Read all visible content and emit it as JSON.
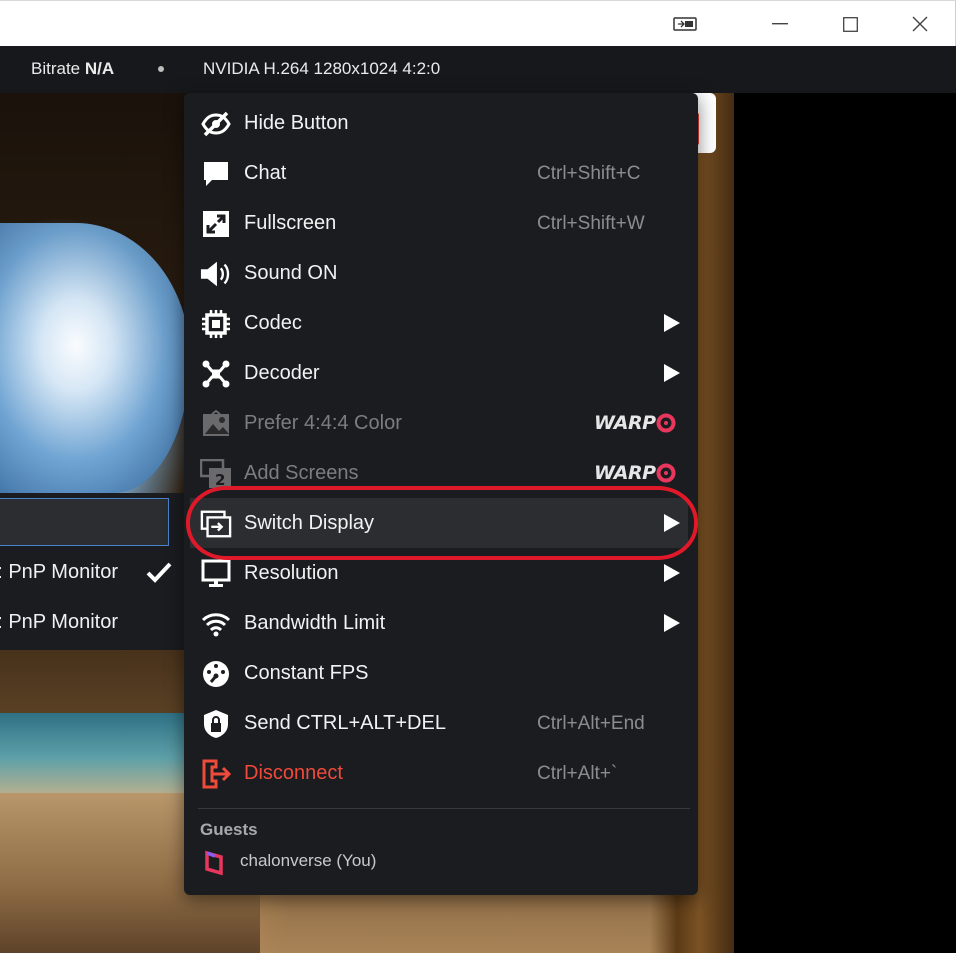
{
  "window": {
    "controls": [
      "mirror-icon",
      "minimize-icon",
      "maximize-icon",
      "close-icon"
    ]
  },
  "stats": {
    "bitrate_label": "Bitrate",
    "bitrate_value": "N/A",
    "codec_info": "NVIDIA H.264 1280x1024 4:2:0"
  },
  "submenu": {
    "items": [
      {
        "label": "",
        "selected": true
      },
      {
        "label": "PnP Monitor",
        "prefix": ":",
        "checked": true
      },
      {
        "label": "PnP Monitor",
        "prefix": ":",
        "checked": false
      }
    ]
  },
  "menu": {
    "items": [
      {
        "label": "Hide Button",
        "shortcut": "",
        "icon": "eye-slash-icon"
      },
      {
        "label": "Chat",
        "shortcut": "Ctrl+Shift+C",
        "icon": "chat-bubble-icon"
      },
      {
        "label": "Fullscreen",
        "shortcut": "Ctrl+Shift+W",
        "icon": "fullscreen-icon"
      },
      {
        "label": "Sound ON",
        "shortcut": "",
        "icon": "speaker-icon"
      },
      {
        "label": "Codec",
        "shortcut": "",
        "icon": "chip-icon",
        "submenu": true
      },
      {
        "label": "Decoder",
        "shortcut": "",
        "icon": "decoder-icon",
        "submenu": true
      },
      {
        "label": "Prefer 4:4:4 Color",
        "shortcut": "",
        "icon": "image-icon",
        "badge": "WARP",
        "disabled": true
      },
      {
        "label": "Add Screens",
        "shortcut": "",
        "icon": "add-screens-icon",
        "badge": "WARP",
        "disabled": true
      },
      {
        "label": "Switch Display",
        "shortcut": "",
        "icon": "switch-display-icon",
        "submenu": true,
        "active": true
      },
      {
        "label": "Resolution",
        "shortcut": "",
        "icon": "monitor-icon",
        "submenu": true
      },
      {
        "label": "Bandwidth Limit",
        "shortcut": "",
        "icon": "wifi-icon",
        "submenu": true
      },
      {
        "label": "Constant FPS",
        "shortcut": "",
        "icon": "gauge-icon"
      },
      {
        "label": "Send CTRL+ALT+DEL",
        "shortcut": "Ctrl+Alt+End",
        "icon": "lock-icon"
      },
      {
        "label": "Disconnect",
        "shortcut": "Ctrl+Alt+`",
        "icon": "disconnect-icon",
        "danger": true
      }
    ],
    "guests_title": "Guests",
    "guests": [
      {
        "name": "chalonverse (You)"
      }
    ]
  },
  "colors": {
    "menu_bg": "#1b1c20",
    "danger": "#ef4a3a",
    "warp_accent": "#e8365d",
    "highlight": "#e0192a"
  }
}
